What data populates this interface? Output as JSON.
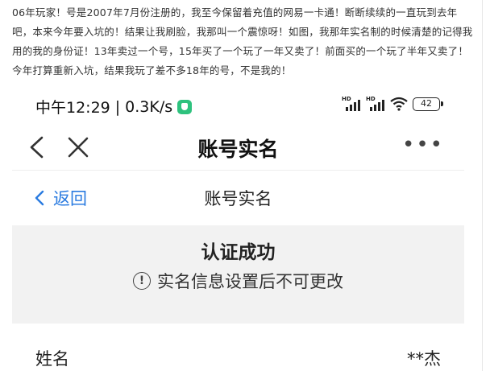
{
  "post": {
    "text": "06年玩家！号是2007年7月份注册的，我至今保留着充值的网易一卡通！断断续续的一直玩到去年吧，本来今年要入坑的！结果让我刷脸，我那叫一个震惊呀！如图，我那年实名制的时候清楚的记得我用的我的身份证！13年卖过一个号，15年买了一个玩了一年又卖了！前面买的一个玩了半年又卖了！今年打算重新入坑，结果我玩了差不多18年的号，不是我的！"
  },
  "statusbar": {
    "time": "中午12:29",
    "speed": "0.3K/s",
    "hd_label": "HD",
    "battery": "42",
    "icons": [
      "shield-icon",
      "signal-icon",
      "signal-icon",
      "wifi-icon",
      "battery-icon"
    ]
  },
  "titlebar": {
    "title": "账号实名",
    "more": "•••",
    "icons": [
      "back-chevron-icon",
      "close-icon",
      "more-icon"
    ]
  },
  "pagebar": {
    "back_label": "返回",
    "title": "账号实名",
    "accent": "#2a7be0"
  },
  "banner": {
    "title": "认证成功",
    "note": "实名信息设置后不可更改",
    "info_glyph": "!",
    "background": "#f2f2f2"
  },
  "fields": [
    {
      "label": "姓名",
      "value": "**杰"
    }
  ]
}
